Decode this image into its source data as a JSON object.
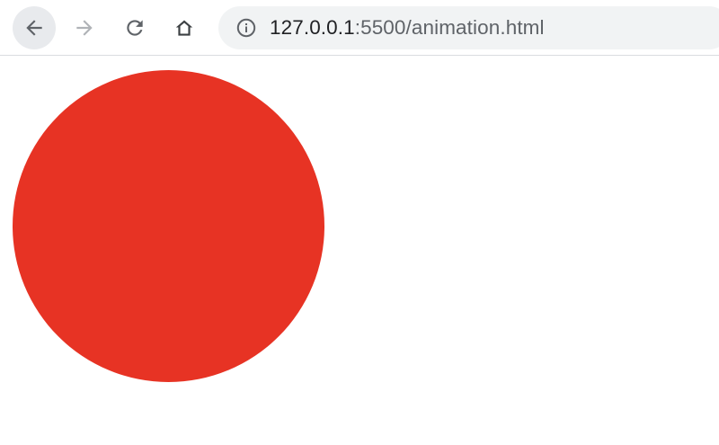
{
  "browser": {
    "nav": {
      "back_icon": "arrow-left-icon",
      "forward_icon": "arrow-right-icon",
      "reload_icon": "reload-icon",
      "home_icon": "home-icon"
    },
    "address_bar": {
      "security_icon": "info-icon",
      "url_host": "127.0.0.1",
      "url_rest": ":5500/animation.html"
    }
  },
  "page": {
    "shape": "circle",
    "circle_color": "#e73324"
  }
}
